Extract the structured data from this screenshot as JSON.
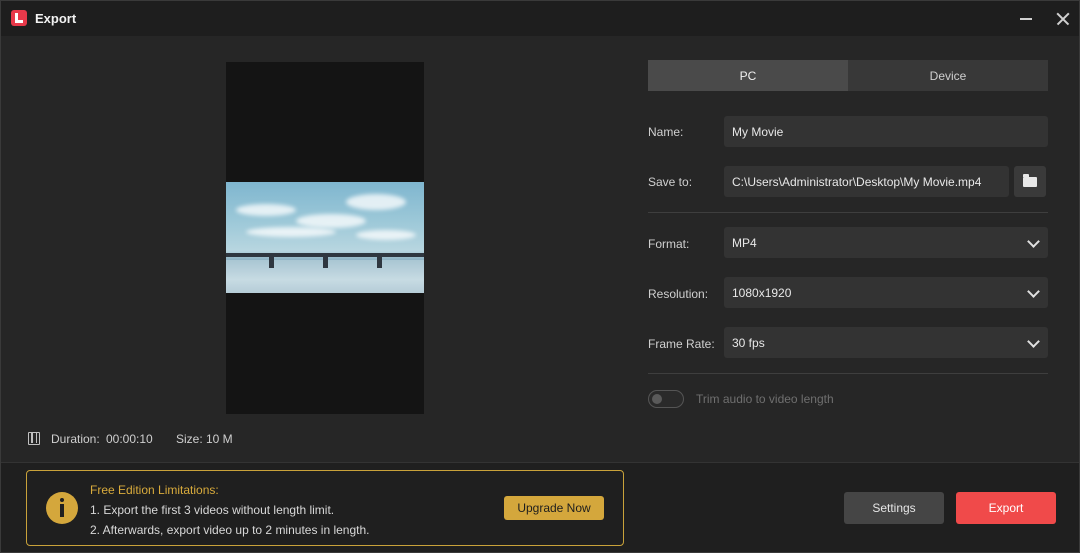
{
  "window": {
    "title": "Export"
  },
  "preview": {
    "duration_label": "Duration:",
    "duration_value": "00:00:10",
    "size_label": "Size:",
    "size_value": "10 M"
  },
  "tabs": [
    {
      "label": "PC",
      "active": true
    },
    {
      "label": "Device",
      "active": false
    }
  ],
  "form": {
    "name_label": "Name:",
    "name_value": "My Movie",
    "save_to_label": "Save to:",
    "save_to_value": "C:\\Users\\Administrator\\Desktop\\My Movie.mp4",
    "format_label": "Format:",
    "format_value": "MP4",
    "resolution_label": "Resolution:",
    "resolution_value": "1080x1920",
    "frame_rate_label": "Frame Rate:",
    "frame_rate_value": "30 fps",
    "trim_audio_label": "Trim audio to video length",
    "trim_audio_enabled": false
  },
  "notice": {
    "title": "Free Edition Limitations:",
    "line1": "1. Export the first 3 videos without length limit.",
    "line2": "2. Afterwards, export video up to 2 minutes in length.",
    "upgrade_label": "Upgrade Now"
  },
  "actions": {
    "settings_label": "Settings",
    "export_label": "Export"
  },
  "colors": {
    "accent_red": "#f04a4a",
    "accent_gold": "#d4a73c"
  }
}
